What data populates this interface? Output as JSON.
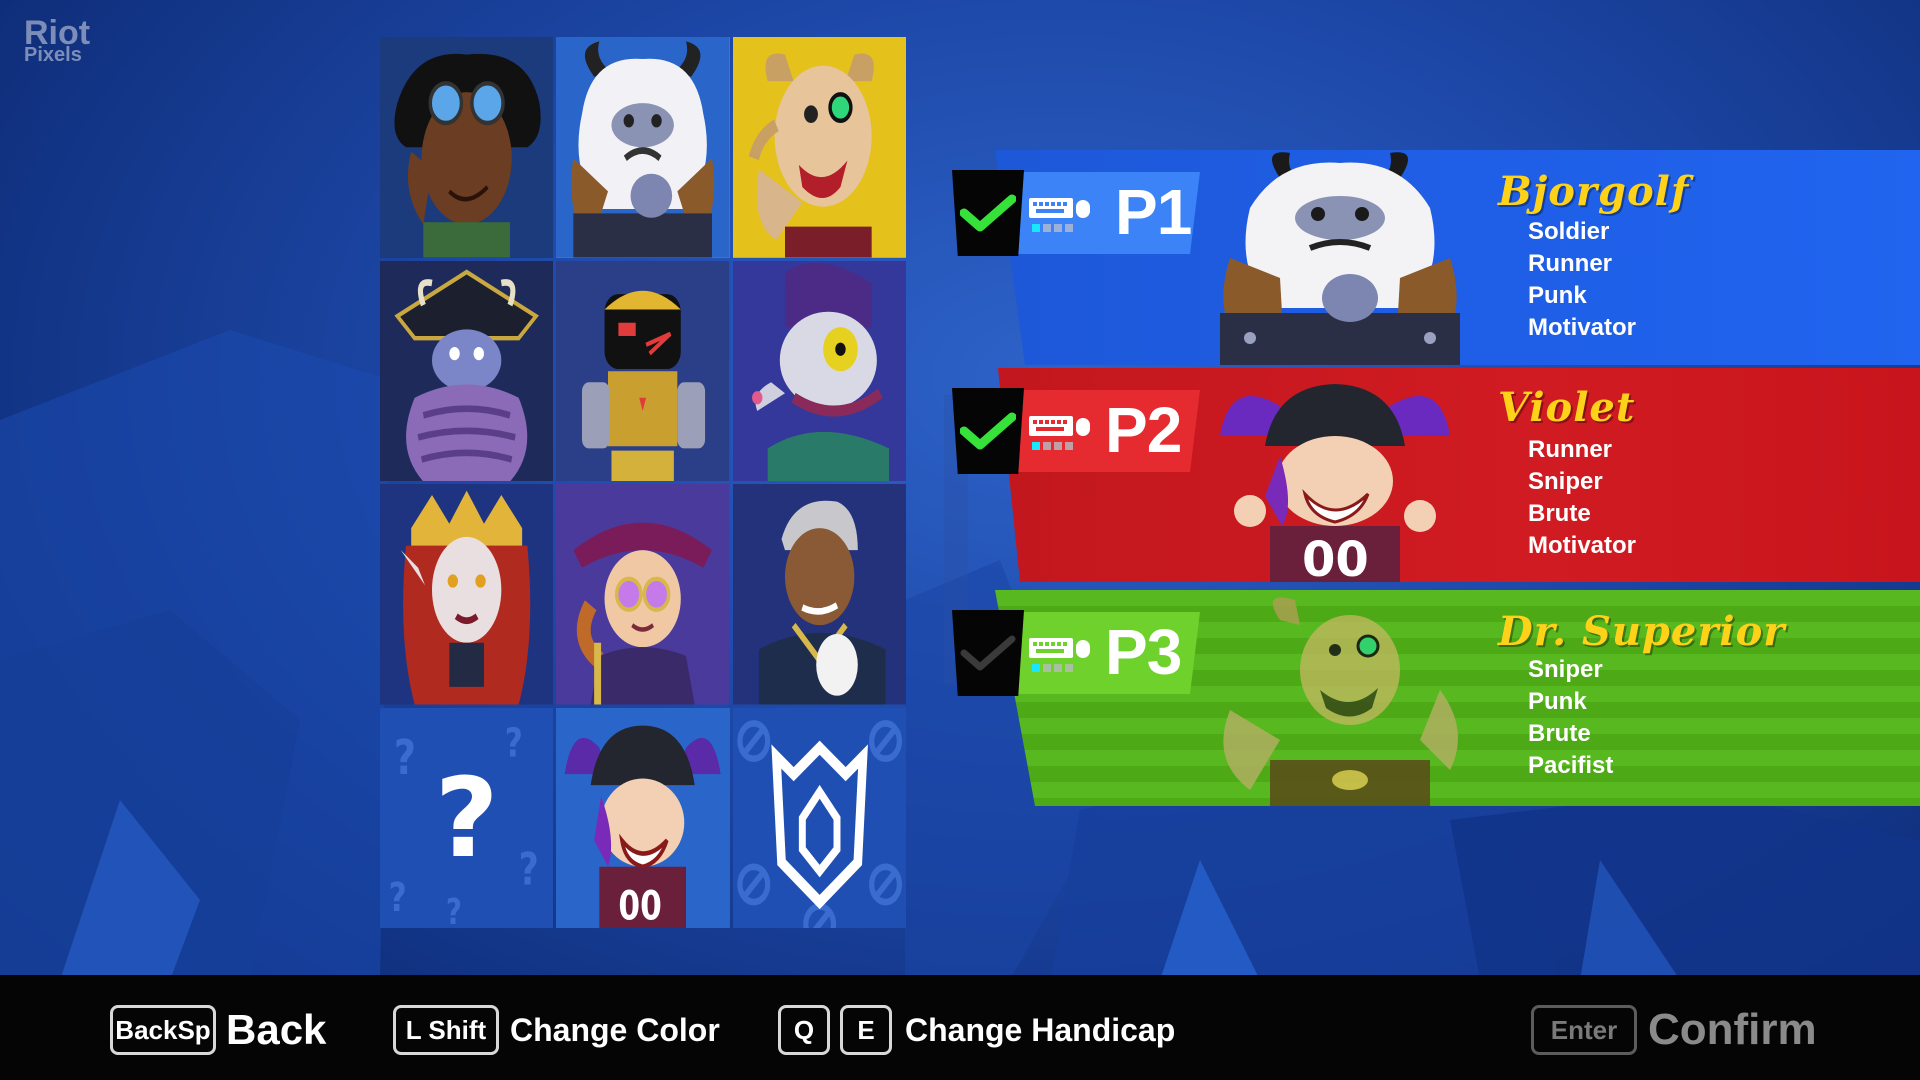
{
  "watermark": {
    "line1": "Riot",
    "line2": "Pixels"
  },
  "roster": {
    "tiles": [
      {
        "name": "goggles-character",
        "state": "none"
      },
      {
        "name": "bjorgolf",
        "state": "p1"
      },
      {
        "name": "dr-superior",
        "state": "p3"
      },
      {
        "name": "armored-ruff-villain",
        "state": "none"
      },
      {
        "name": "robot-hero",
        "state": "none"
      },
      {
        "name": "rat-villain",
        "state": "none"
      },
      {
        "name": "red-queen",
        "state": "none"
      },
      {
        "name": "lady-with-monocle-glasses",
        "state": "none"
      },
      {
        "name": "silver-haired-gentleman",
        "state": "none"
      },
      {
        "name": "random-select",
        "state": "none",
        "label": "?"
      },
      {
        "name": "violet",
        "state": "p2"
      },
      {
        "name": "locked-crest",
        "state": "none"
      }
    ]
  },
  "players": [
    {
      "tag": "P1",
      "ready": true,
      "character": "Bjorgolf",
      "traits": [
        "Soldier",
        "Runner",
        "Punk",
        "Motivator"
      ],
      "color": "#1f5ee6"
    },
    {
      "tag": "P2",
      "ready": true,
      "character": "Violet",
      "traits": [
        "Runner",
        "Sniper",
        "Brute",
        "Motivator"
      ],
      "color": "#d11b22"
    },
    {
      "tag": "P3",
      "ready": false,
      "character": "Dr. Superior",
      "traits": [
        "Sniper",
        "Punk",
        "Brute",
        "Pacifist"
      ],
      "color": "#58b81f"
    }
  ],
  "controls": {
    "back_key": "BackSp",
    "back_label": "Back",
    "color_key": "L Shift",
    "color_label": "Change Color",
    "handicap_key_1": "Q",
    "handicap_key_2": "E",
    "handicap_label": "Change Handicap",
    "confirm_key": "Enter",
    "confirm_label": "Confirm"
  },
  "colors": {
    "accent_name": "#ffd21a",
    "check": "#36e23a"
  }
}
